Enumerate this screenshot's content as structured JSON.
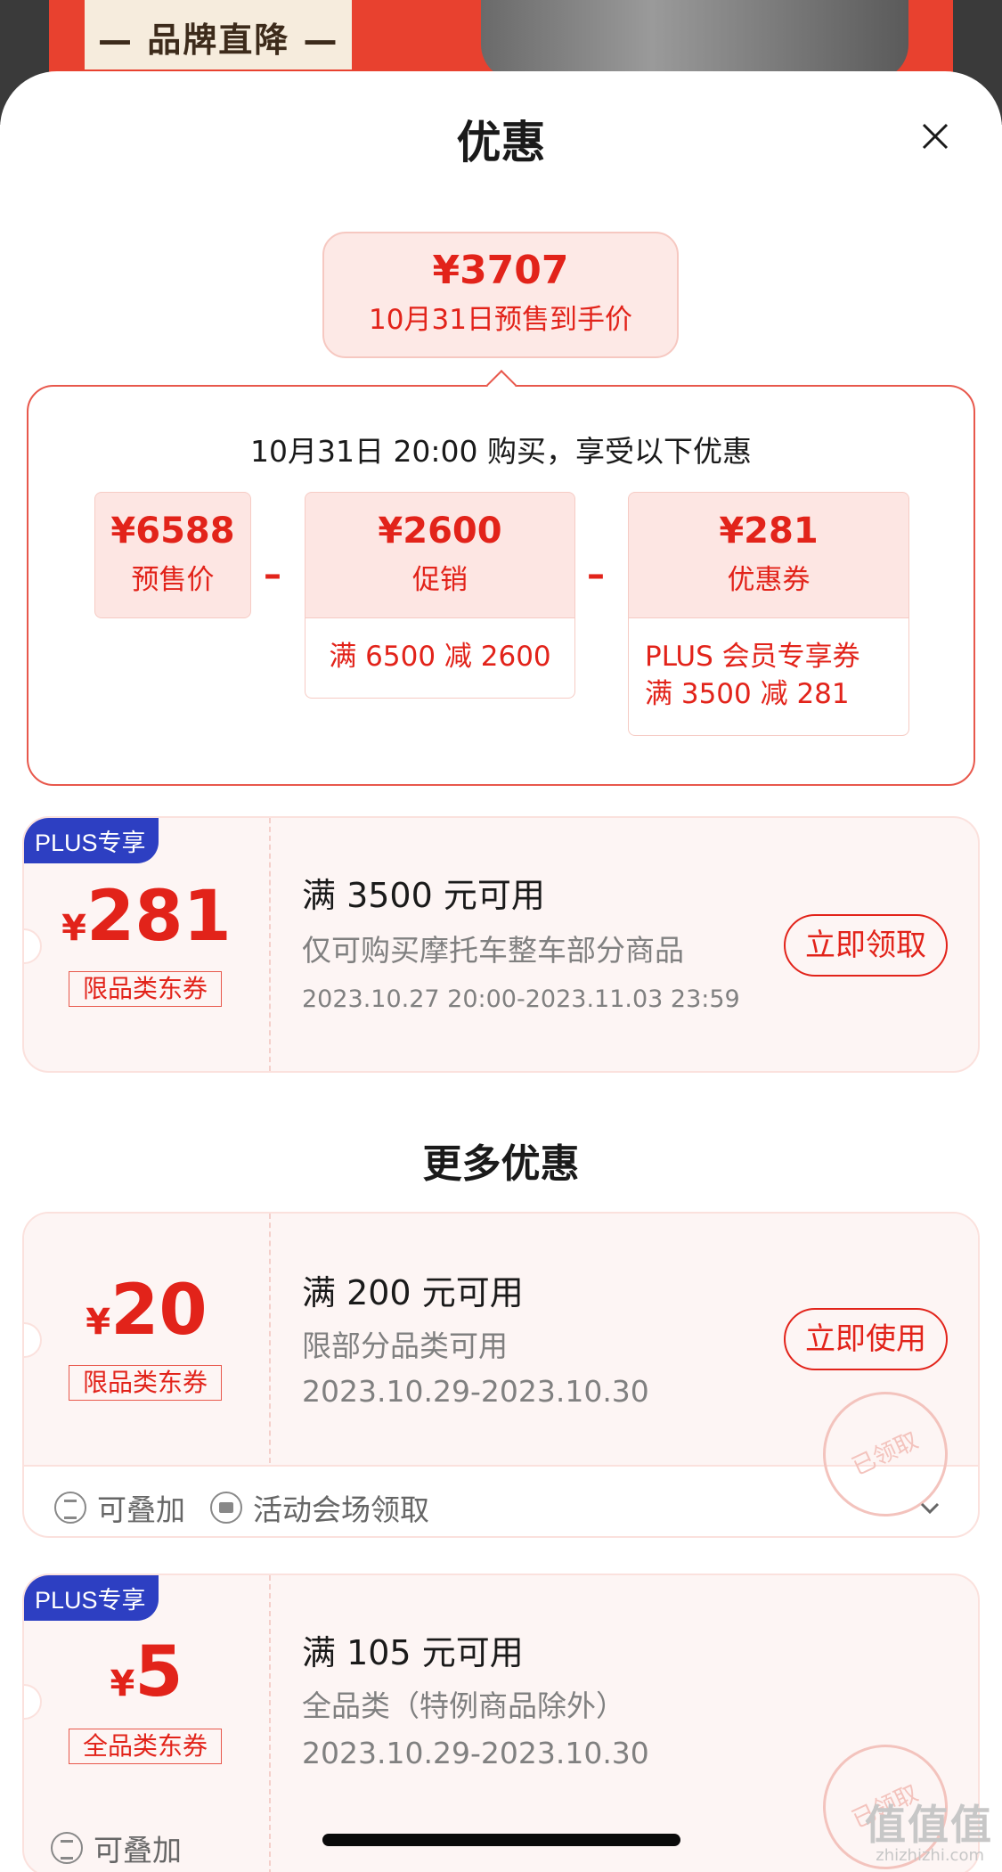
{
  "banner": {
    "brand_text": "— 品牌直降 —"
  },
  "sheet": {
    "title": "优惠",
    "close_icon": "close-icon"
  },
  "final_price": {
    "amount": "¥3707",
    "desc": "10月31日预售到手价"
  },
  "breakdown": {
    "headline": "10月31日 20:00 购买，享受以下优惠",
    "minus": "–",
    "items": [
      {
        "value": "¥6588",
        "label": "预售价",
        "detail": ""
      },
      {
        "value": "¥2600",
        "label": "促销",
        "detail": "满 6500 减 2600"
      },
      {
        "value": "¥281",
        "label": "优惠券",
        "detail_line1": "PLUS 会员专享券",
        "detail_line2": "满 3500 减 281"
      }
    ]
  },
  "coupons": [
    {
      "badge": "PLUS专享",
      "yen": "¥",
      "amount": "281",
      "scope": "限品类东券",
      "condition": "满 3500 元可用",
      "restriction": "仅可购买摩托车整车部分商品",
      "dates": "2023.10.27 20:00-2023.11.03 23:59",
      "action": "立即领取"
    }
  ],
  "more_title": "更多优惠",
  "more_coupons": [
    {
      "yen": "¥",
      "amount": "20",
      "scope": "限品类东券",
      "condition": "满 200 元可用",
      "restriction": "限部分品类可用",
      "dates": "2023.10.29-2023.10.30",
      "action": "立即使用",
      "stamp": "已领取",
      "tags": [
        "可叠加",
        "活动会场领取"
      ]
    },
    {
      "badge": "PLUS专享",
      "yen": "¥",
      "amount": "5",
      "scope": "全品类东券",
      "condition": "满 105 元可用",
      "restriction": "全品类（特例商品除外）",
      "dates": "2023.10.29-2023.10.30",
      "stamp": "已领取",
      "tags": [
        "可叠加"
      ]
    }
  ],
  "watermark": {
    "main": "值值值",
    "sub": "zhizhizhi.com"
  },
  "colors": {
    "accent": "#e2231a",
    "plus_badge": "#2d3fc2",
    "tile_bg": "#fde6e3",
    "card_bg": "#fdf5f4"
  }
}
